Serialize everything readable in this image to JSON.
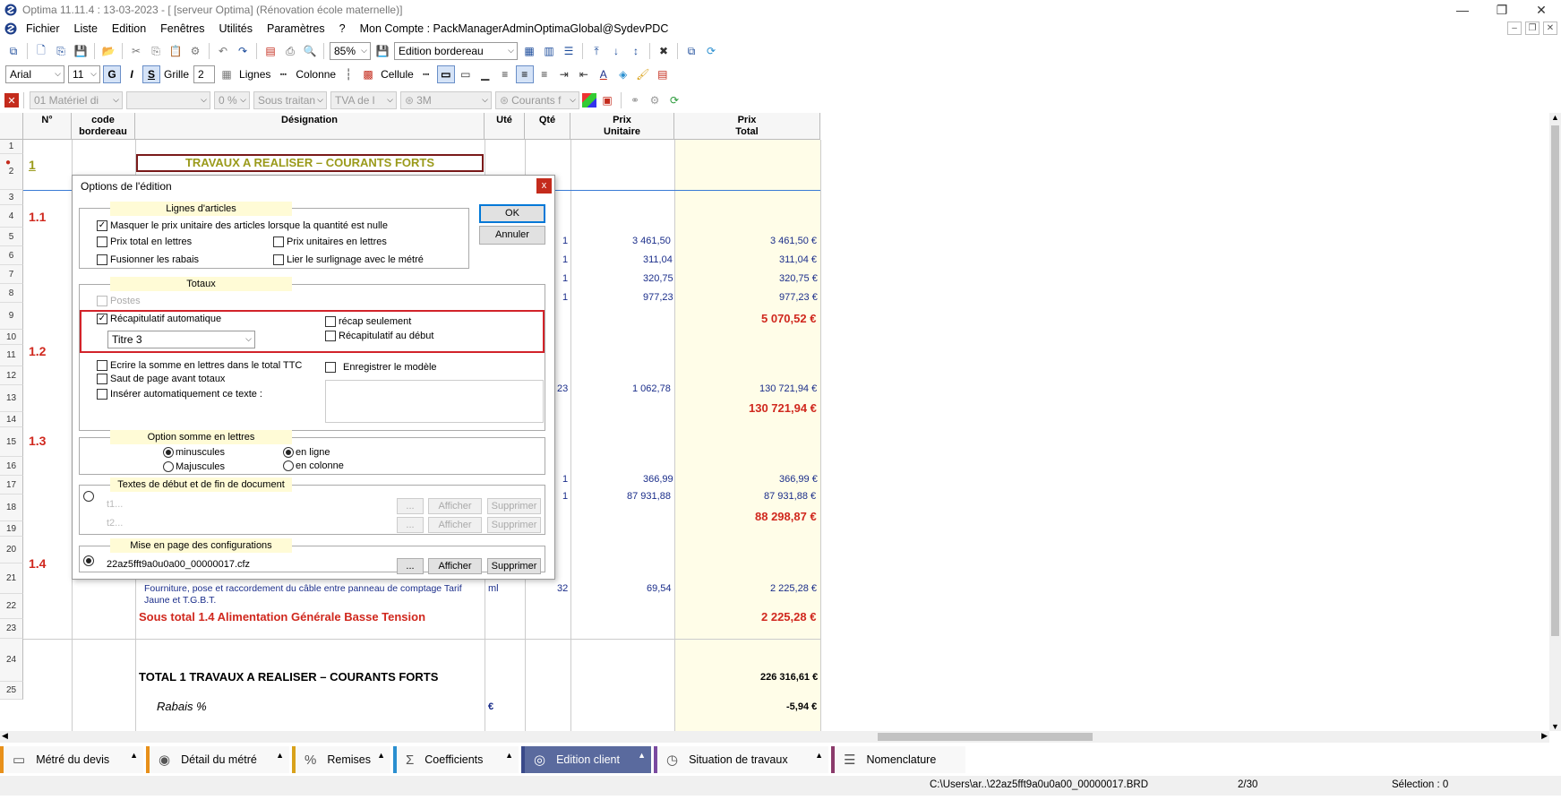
{
  "window": {
    "title": "Optima 11.11.4 : 13-03-2023 - [ [serveur Optima] (Rénovation école maternelle)]",
    "controls": [
      "—",
      "❐",
      "✕"
    ]
  },
  "menu": {
    "items": [
      "Fichier",
      "Liste",
      "Edition",
      "Fenêtres",
      "Utilités",
      "Paramètres",
      "?",
      "Mon Compte : PackManagerAdminOptimaGlobal@SydevPDC"
    ]
  },
  "toolbar1": {
    "zoom": "85%",
    "mode": "Edition bordereau"
  },
  "toolbar2": {
    "font": "Arial",
    "size": "11",
    "bold": "G",
    "italic": "I",
    "strike": "S",
    "grid_label": "Grille",
    "grid_value": "2",
    "lines_label": "Lignes",
    "column_label": "Colonne",
    "cell_label": "Cellule"
  },
  "toolbar3": {
    "materiel": "01  Matériel di",
    "pct": "0 %",
    "sous_traitant": "Sous traitan",
    "tva": "TVA de l",
    "unit3m": "3M",
    "courants": "Courants f"
  },
  "sheet": {
    "headers": {
      "num": "N°",
      "code": "code\nbordereau",
      "designation": "Désignation",
      "ute": "Uté",
      "qte": "Qté",
      "pu": "Prix\nUnitaire",
      "pt": "Prix\nTotal"
    },
    "row_numbers": [
      "1",
      "2",
      "3",
      "4",
      "5",
      "6",
      "7",
      "8",
      "9",
      "10",
      "11",
      "12",
      "13",
      "14",
      "15",
      "16",
      "17",
      "18",
      "19",
      "20",
      "21",
      "22",
      "23",
      "24",
      "25"
    ],
    "section_1": "1",
    "section_1_title": "TRAVAUX A REALISER – COURANTS FORTS",
    "subsections": [
      "1.1",
      "1.2",
      "1.3",
      "1.4"
    ],
    "rows": {
      "r5": {
        "qte": "1",
        "pu": "3 461,50",
        "pt": "3 461,50 €"
      },
      "r6": {
        "qte": "1",
        "pu": "311,04",
        "pt": "311,04 €"
      },
      "r7": {
        "qte": "1",
        "pu": "320,75",
        "pt": "320,75 €"
      },
      "r8": {
        "qte": "1",
        "pu": "977,23",
        "pt": "977,23 €"
      },
      "r9": {
        "pt": "5 070,52 €"
      },
      "r12": {
        "qte": "23",
        "pu": "1 062,78",
        "pt": "130 721,94 €"
      },
      "r13": {
        "pt": "130 721,94 €"
      },
      "r16": {
        "qte": "1",
        "pu": "366,99",
        "pt": "366,99 €"
      },
      "r17": {
        "qte": "1",
        "pu": "87 931,88",
        "pt": "87 931,88 €"
      },
      "r18": {
        "pt": "88 298,87 €"
      },
      "r21": {
        "designation": "Fourniture, pose et raccordement du câble entre panneau de comptage Tarif Jaune et T.G.B.T.",
        "ute": "ml",
        "qte": "32",
        "pu": "69,54",
        "pt": "2 225,28 €"
      },
      "r22": {
        "designation": "Sous total 1.4 Alimentation Générale Basse Tension",
        "pt": "2 225,28 €"
      },
      "r24": {
        "designation": "TOTAL 1 TRAVAUX A REALISER – COURANTS FORTS",
        "pt": "226 316,61 €"
      },
      "r25": {
        "designation": "Rabais %",
        "ute": "€",
        "pt": "-5,94 €"
      }
    }
  },
  "dialog": {
    "title": "Options de l'édition",
    "close": "x",
    "ok": "OK",
    "cancel": "Annuler",
    "group_lignes": "Lignes d'articles",
    "masquer": "Masquer le prix unitaire des articles lorsque la quantité est nulle",
    "prix_total_lettres": "Prix total en lettres",
    "prix_unit_lettres": "Prix unitaires en lettres",
    "fusionner": "Fusionner les rabais",
    "lier": "Lier le surlignage avec le métré",
    "group_totaux": "Totaux",
    "postes": "Postes",
    "recap_auto": "Récapitulatif automatique",
    "recap_seul": "récap seulement",
    "recap_debut": "Récapitulatif au début",
    "titre_select": "Titre 3",
    "ecrire_somme": "Ecrire la somme en lettres dans le total TTC",
    "saut_page": "Saut de page avant totaux",
    "inserer": "Insérer automatiquement ce texte :",
    "enregistrer": "Enregistrer le modèle",
    "group_option": "Option somme en lettres",
    "minuscules": "minuscules",
    "majuscules": "Majuscules",
    "en_ligne": "en ligne",
    "en_colonne": "en colonne",
    "group_textes": "Textes de début et de fin de document",
    "t1": "t1...",
    "t2": "t2...",
    "dots": "...",
    "afficher": "Afficher",
    "supprimer": "Supprimer",
    "group_mise": "Mise en page des configurations",
    "config_file": "22az5fft9a0u0a00_00000017.cfz"
  },
  "tabs": [
    {
      "label": "Métré du devis",
      "icon": "ruler-icon",
      "color": "#e8901a"
    },
    {
      "label": "Détail du métré",
      "icon": "eye-icon",
      "color": "#e8901a"
    },
    {
      "label": "Remises",
      "icon": "percent-icon",
      "color": "#d9a21b"
    },
    {
      "label": "Coefficients",
      "icon": "sigma-icon",
      "color": "#2a8fd0"
    },
    {
      "label": "Edition client",
      "icon": "user-icon",
      "color": "#3a4a8a"
    },
    {
      "label": "Situation de travaux",
      "icon": "clock-icon",
      "color": "#7a4aa0"
    },
    {
      "label": "Nomenclature",
      "icon": "list-icon",
      "color": "#8a3a6a"
    }
  ],
  "status": {
    "path": "C:\\Users\\ar..\\22az5fft9a0u0a00_00000017.BRD",
    "pages": "2/30",
    "selection": "Sélection : 0"
  },
  "colors": {
    "accent": "#3a4a8a",
    "total_red": "#d0281e",
    "value_blue": "#1a2d8a",
    "highlight": "#d2232a"
  }
}
